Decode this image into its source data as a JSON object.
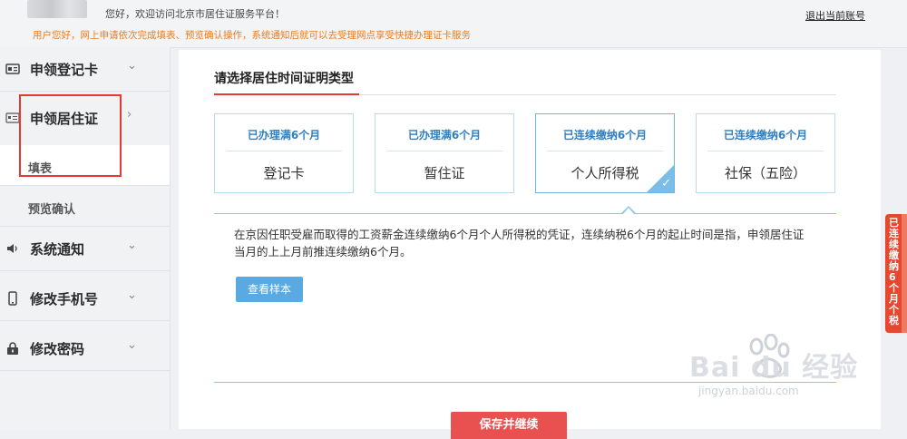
{
  "topbar": {
    "welcome": "您好，欢迎访问北京市居住证服务平台！",
    "notice": "用户您好，网上申请依次完成填表、预览确认操作，系统通知后就可以去受理网点享受快捷办理证卡服务",
    "logout": "退出当前账号"
  },
  "sidebar": {
    "items": [
      {
        "label": "申领登记卡",
        "icon": "id-card-icon",
        "chevron": "⌄"
      },
      {
        "label": "申领居住证",
        "icon": "id-card-icon",
        "chevron": "›"
      },
      {
        "label": "系统通知",
        "icon": "speaker-icon",
        "chevron": "⌄"
      },
      {
        "label": "修改手机号",
        "icon": "phone-icon",
        "chevron": "⌄"
      },
      {
        "label": "修改密码",
        "icon": "lock-icon",
        "chevron": "⌄"
      }
    ],
    "subitems": [
      {
        "label": "填表",
        "active": true
      },
      {
        "label": "预览确认",
        "active": false
      }
    ]
  },
  "content": {
    "section_title": "请选择居住时间证明类型",
    "cards": [
      {
        "top": "已办理满6个月",
        "main": "登记卡",
        "selected": false
      },
      {
        "top": "已办理满6个月",
        "main": "暂住证",
        "selected": false
      },
      {
        "top": "已连续缴纳6个月",
        "main": "个人所得税",
        "selected": true
      },
      {
        "top": "已连续缴纳6个月",
        "main": "社保（五险）",
        "selected": false
      }
    ],
    "description": "在京因任职受雇而取得的工资薪金连续缴纳6个月个人所得税的凭证，连续纳税6个月的起止时间是指，申领居住证当月的上上月前推连续缴纳6个月。",
    "sample_button": "查看样本",
    "save_button": "保存并继续"
  },
  "side_tab": {
    "text": "已连续缴纳6个月个税"
  },
  "watermark": {
    "main": "Bai du 经验",
    "sub": "jingyan.baidu.com"
  },
  "colors": {
    "accent": "#2f7fc1",
    "danger": "#e53935",
    "notice": "#ec7d1f"
  }
}
